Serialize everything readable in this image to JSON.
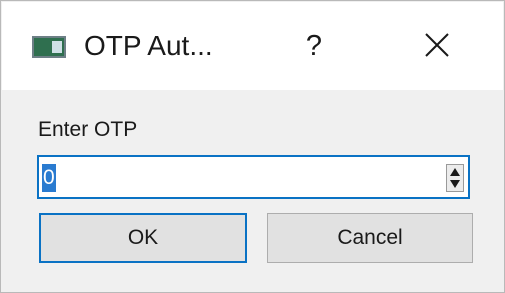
{
  "window": {
    "title": "OTP Aut...",
    "help_glyph": "?",
    "icons": {
      "app": "app-window-icon",
      "close": "close-icon"
    }
  },
  "form": {
    "label": "Enter OTP",
    "spinbox_value": "0"
  },
  "buttons": {
    "ok_label": "OK",
    "cancel_label": "Cancel"
  },
  "colors": {
    "accent": "#0a72c4",
    "selection": "#2a7bd0",
    "button_face": "#e1e1e1",
    "dialog_bg": "#f0f0f0"
  }
}
